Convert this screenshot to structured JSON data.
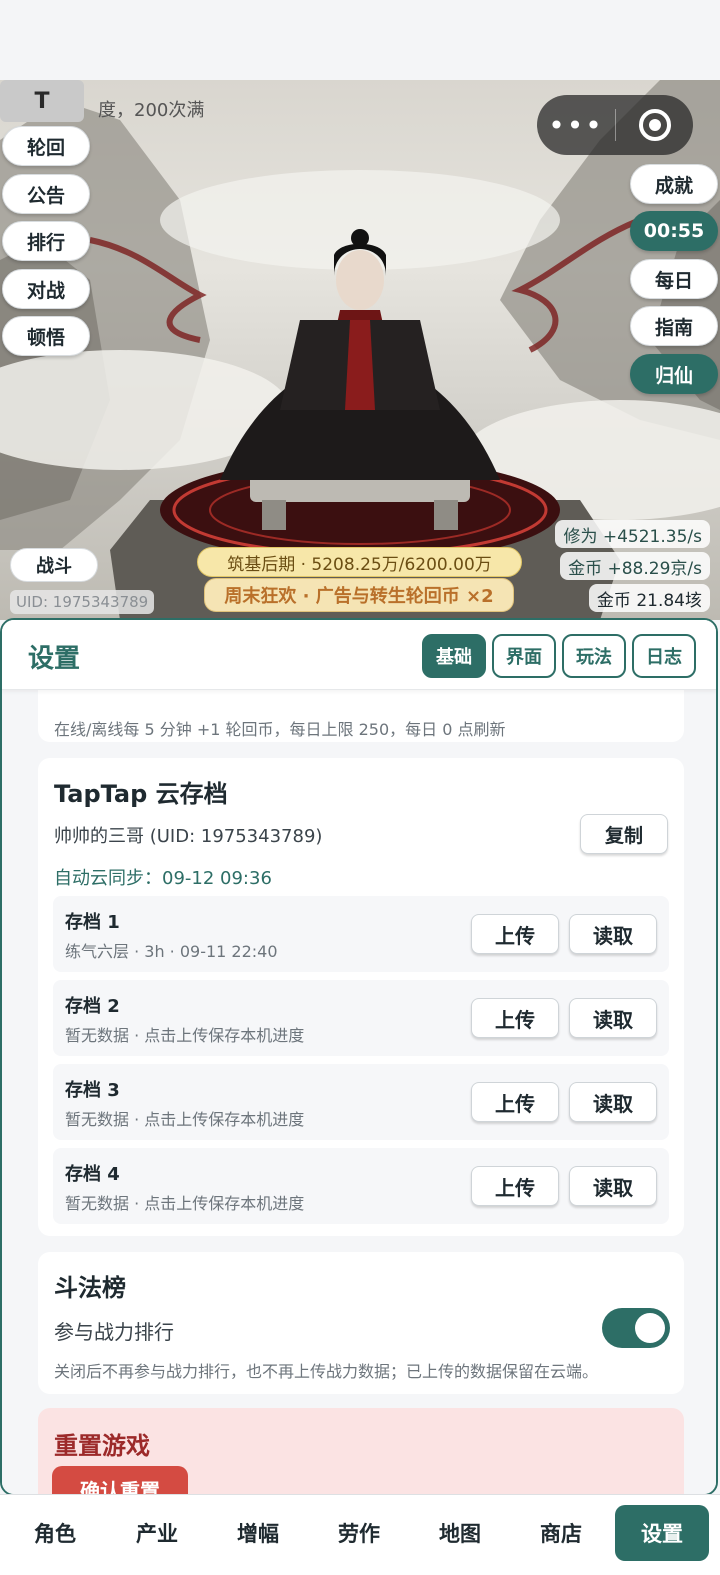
{
  "hud": {
    "avatar_letter": "T",
    "progress_hint": "度，200次满",
    "left_buttons": [
      "轮回",
      "公告",
      "排行",
      "对战",
      "顿悟"
    ],
    "right_buttons": [
      "成就",
      "00:55",
      "每日",
      "指南",
      "归仙"
    ],
    "battle": "战斗",
    "uid": "UID: 1975343789",
    "stats": {
      "cultivation": "修为 +4521.35/s",
      "gold_rate": "金币 +88.29京/s",
      "gold_total": "金币 21.84垓"
    },
    "realm": "筑基后期 · 5208.25万/6200.00万",
    "weekend_banner": "周末狂欢 · 广告与转生轮回币 ×2",
    "capsule_more": "•••",
    "capsule_icon": "target-icon"
  },
  "settings": {
    "title": "设置",
    "tabs": [
      {
        "label": "基础",
        "active": true
      },
      {
        "label": "界面",
        "active": false
      },
      {
        "label": "玩法",
        "active": false
      },
      {
        "label": "日志",
        "active": false
      }
    ],
    "clipped_line": "在线/离线每 5 分钟 +1 轮回币，每日上限 250，每日 0 点刷新",
    "cloud": {
      "title": "TapTap 云存档",
      "user": "帅帅的三哥 (UID: 1975343789)",
      "copy": "复制",
      "auto_sync": "自动云同步：09-12 09:36",
      "upload": "上传",
      "load": "读取",
      "slots": [
        {
          "name": "存档 1",
          "desc": "练气六层 · 3h · 09-11 22:40"
        },
        {
          "name": "存档 2",
          "desc": "暂无数据 · 点击上传保存本机进度"
        },
        {
          "name": "存档 3",
          "desc": "暂无数据 · 点击上传保存本机进度"
        },
        {
          "name": "存档 4",
          "desc": "暂无数据 · 点击上传保存本机进度"
        }
      ]
    },
    "ranking": {
      "title": "斗法榜",
      "label": "参与战力排行",
      "enabled": true,
      "note": "关闭后不再参与战力排行，也不再上传战力数据；已上传的数据保留在云端。"
    },
    "reset": {
      "title": "重置游戏",
      "button": "确认重置"
    }
  },
  "nav": [
    {
      "label": "角色",
      "active": false
    },
    {
      "label": "产业",
      "active": false
    },
    {
      "label": "增幅",
      "active": false
    },
    {
      "label": "劳作",
      "active": false
    },
    {
      "label": "地图",
      "active": false
    },
    {
      "label": "商店",
      "active": false
    },
    {
      "label": "设置",
      "active": true
    }
  ],
  "colors": {
    "accent": "#2d6e66",
    "danger": "#d44b42",
    "gold_banner": "#f7e7a9"
  }
}
